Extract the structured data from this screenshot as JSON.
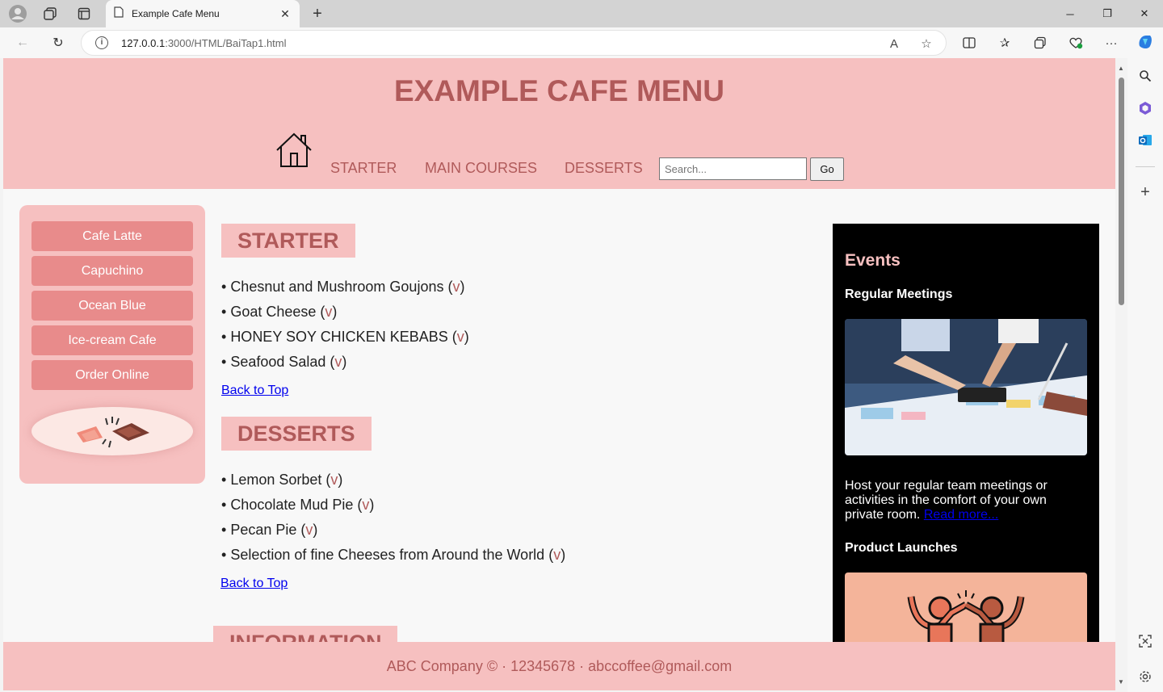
{
  "browser": {
    "tab_title": "Example Cafe Menu",
    "url_host": "127.0.0.1",
    "url_path": ":3000/HTML/BaiTap1.html",
    "new_tab": "+",
    "window_controls": {
      "minimize": "─",
      "restore": "❐",
      "close": "✕"
    }
  },
  "header": {
    "title": "EXAMPLE CAFE MENU",
    "nav": [
      "STARTER",
      "MAIN COURSES",
      "DESSERTS"
    ],
    "search_placeholder": "Search...",
    "go_label": "Go"
  },
  "sidebar": {
    "buttons": [
      "Cafe Latte",
      "Capuchino",
      "Ocean Blue",
      "Ice-cream Cafe",
      "Order Online"
    ]
  },
  "sections": [
    {
      "heading": "STARTER",
      "items": [
        "Chesnut and Mushroom Goujons",
        "Goat Cheese",
        "HONEY SOY CHICKEN KEBABS",
        "Seafood Salad"
      ],
      "back_to_top": "Back to Top"
    },
    {
      "heading": "DESSERTS",
      "items": [
        "Lemon Sorbet",
        "Chocolate Mud Pie",
        "Pecan Pie",
        "Selection of fine Cheeses from Around the World"
      ],
      "back_to_top": "Back to Top"
    },
    {
      "heading": "INFORMATION"
    }
  ],
  "item_marker": "v",
  "events": {
    "title": "Events",
    "regular_title": "Regular Meetings",
    "regular_text": "Host your regular team meetings or activities in the comfort of your own private room.",
    "read_more": "Read more...",
    "launch_title": "Product Launches"
  },
  "footer": {
    "text": "ABC Company © · 12345678 · abccoffee@gmail.com"
  },
  "colors": {
    "accent_pink": "#f6c0c0",
    "accent_text": "#b05a5a",
    "button_pink": "#e88b8b"
  }
}
